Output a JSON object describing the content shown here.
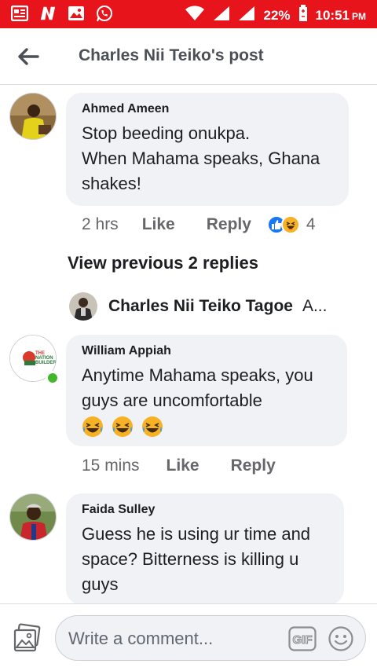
{
  "status_bar": {
    "battery": "22%",
    "time": "10:51",
    "ampm": "PM",
    "bg_color": "#e8141c"
  },
  "header": {
    "title": "Charles Nii Teiko's post"
  },
  "comments": [
    {
      "author": "Ahmed Ameen",
      "text_lines": [
        "Stop beeding onukpa.",
        "When Mahama speaks, Ghana",
        "shakes!"
      ],
      "time": "2 hrs",
      "like": "Like",
      "reply": "Reply",
      "reaction_count": "4"
    },
    {
      "author": "William Appiah",
      "text_lines": [
        "Anytime Mahama speaks, you",
        "guys are uncomfortable"
      ],
      "time": "15 mins",
      "like": "Like",
      "reply": "Reply"
    },
    {
      "author": "Faida Sulley",
      "text_lines": [
        "Guess he is using ur time and",
        "space? Bitterness is killing u",
        "guys"
      ]
    }
  ],
  "view_previous": "View previous 2 replies",
  "reply_preview": {
    "name": "Charles Nii Teiko Tagoe",
    "snippet": "A",
    "ellipsis": "..."
  },
  "composer": {
    "placeholder": "Write a comment..."
  }
}
